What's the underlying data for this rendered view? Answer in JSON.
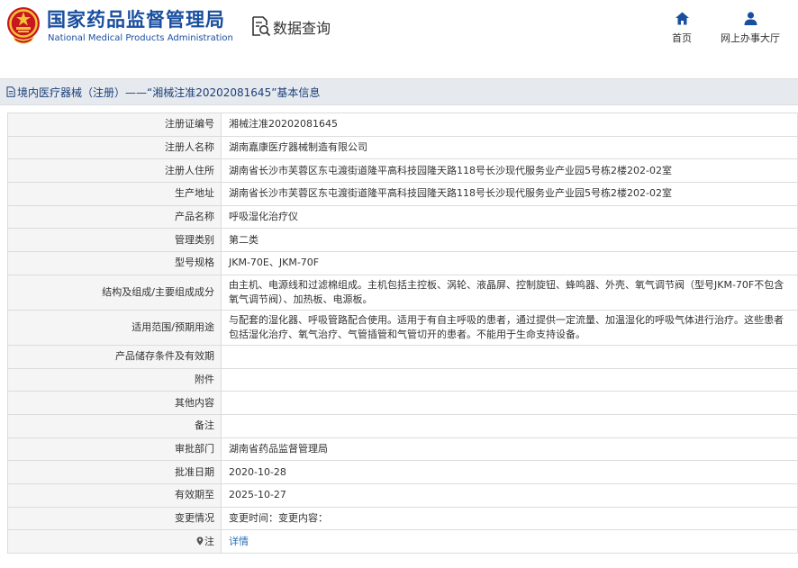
{
  "header": {
    "brand_cn": "国家药品监督管理局",
    "brand_en": "National Medical Products Administration",
    "data_query": "数据查询",
    "nav": [
      {
        "label": "首页",
        "icon": "home-icon"
      },
      {
        "label": "网上办事大厅",
        "icon": "user-icon"
      }
    ]
  },
  "breadcrumb": {
    "text": "境内医疗器械（注册）——“湘械注准20202081645”基本信息"
  },
  "rows": [
    {
      "label": "注册证编号",
      "value": "湘械注准20202081645"
    },
    {
      "label": "注册人名称",
      "value": "湖南嘉康医疗器械制造有限公司"
    },
    {
      "label": "注册人住所",
      "value": "湖南省长沙市芙蓉区东屯渡街道隆平高科技园隆天路118号长沙现代服务业产业园5号栋2楼202-02室"
    },
    {
      "label": "生产地址",
      "value": "湖南省长沙市芙蓉区东屯渡街道隆平高科技园隆天路118号长沙现代服务业产业园5号栋2楼202-02室"
    },
    {
      "label": "产品名称",
      "value": "呼吸湿化治疗仪"
    },
    {
      "label": "管理类别",
      "value": "第二类"
    },
    {
      "label": "型号规格",
      "value": "JKM-70E、JKM-70F"
    },
    {
      "label": "结构及组成/主要组成成分",
      "value": "由主机、电源线和过滤棉组成。主机包括主控板、涡轮、液晶屏、控制旋钮、蜂鸣器、外壳、氧气调节阀（型号JKM-70F不包含氧气调节阀）、加热板、电源板。"
    },
    {
      "label": "适用范围/预期用途",
      "value": "与配套的湿化器、呼吸管路配合使用。适用于有自主呼吸的患者，通过提供一定流量、加温湿化的呼吸气体进行治疗。这些患者包括湿化治疗、氧气治疗、气管插管和气管切开的患者。不能用于生命支持设备。"
    },
    {
      "label": "产品储存条件及有效期",
      "value": ""
    },
    {
      "label": "附件",
      "value": ""
    },
    {
      "label": "其他内容",
      "value": ""
    },
    {
      "label": "备注",
      "value": ""
    },
    {
      "label": "审批部门",
      "value": "湖南省药品监督管理局"
    },
    {
      "label": "批准日期",
      "value": "2020-10-28"
    },
    {
      "label": "有效期至",
      "value": "2025-10-27"
    },
    {
      "label": "变更情况",
      "value": "变更时间：变更内容："
    }
  ],
  "note_row": {
    "label": "注",
    "link": "详情"
  },
  "colors": {
    "brand_blue": "#1a4fa0",
    "breadcrumb_bg": "#e6eaee",
    "label_bg": "#f5f5f5",
    "link": "#2a6fb5"
  }
}
